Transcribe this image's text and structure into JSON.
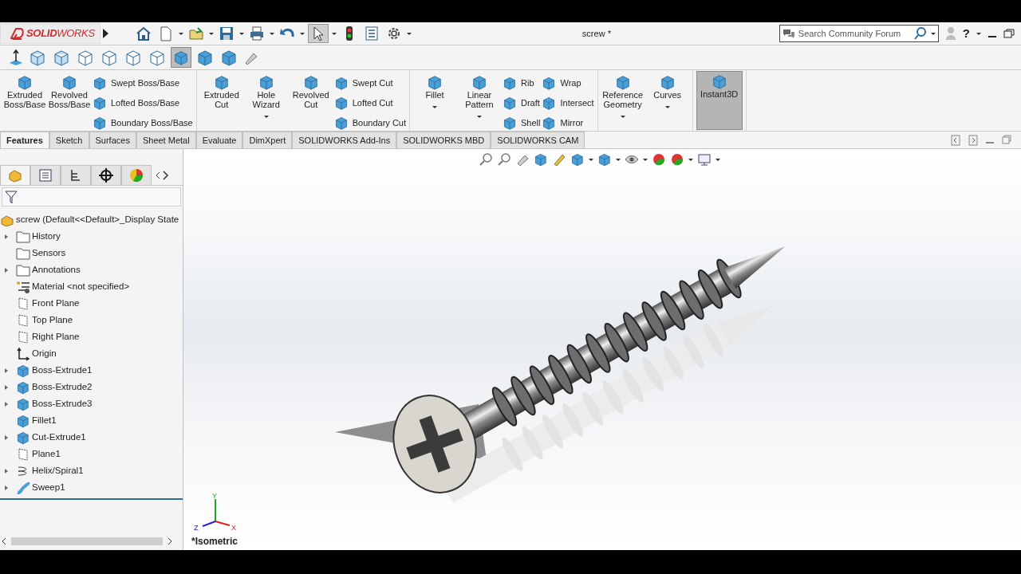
{
  "app": {
    "logo": "**SOLID**WORKS"
  },
  "window": {
    "title": "screw *"
  },
  "search": {
    "placeholder": "Search Community Forum"
  },
  "help": "?",
  "quick_tools": [
    {
      "kind": "home",
      "selected": false
    },
    {
      "kind": "new",
      "selected": false
    },
    {
      "kind": "open",
      "selected": false
    },
    {
      "kind": "save",
      "selected": false
    },
    {
      "kind": "print",
      "selected": false
    },
    {
      "kind": "undo",
      "selected": false
    },
    {
      "kind": "select",
      "selected": true
    },
    {
      "kind": "rebuild",
      "selected": false
    },
    {
      "kind": "file-properties",
      "selected": false
    },
    {
      "kind": "options",
      "selected": false
    }
  ],
  "view_tools": [
    {
      "selected": false
    },
    {
      "selected": false
    },
    {
      "selected": false
    },
    {
      "selected": false
    },
    {
      "selected": false
    },
    {
      "selected": false
    },
    {
      "selected": true
    },
    {
      "selected": false
    },
    {
      "selected": false
    }
  ],
  "ribbon": [
    {
      "items": [
        {
          "kind": "large",
          "label": "Extruded Boss/Base",
          "dropdown": false
        },
        {
          "kind": "large",
          "label": "Revolved Boss/Base",
          "dropdown": false
        },
        {
          "kind": "stack",
          "labels": [
            "Swept Boss/Base",
            "Lofted Boss/Base",
            "Boundary Boss/Base"
          ]
        }
      ]
    },
    {
      "items": [
        {
          "kind": "large",
          "label": "Extruded Cut",
          "dropdown": false
        },
        {
          "kind": "large",
          "label": "Hole Wizard",
          "dropdown": true
        },
        {
          "kind": "large",
          "label": "Revolved Cut",
          "dropdown": false
        },
        {
          "kind": "stack",
          "labels": [
            "Swept Cut",
            "Lofted Cut",
            "Boundary Cut"
          ]
        }
      ]
    },
    {
      "items": [
        {
          "kind": "large",
          "label": "Fillet",
          "dropdown": true
        },
        {
          "kind": "large",
          "label": "Linear Pattern",
          "dropdown": true
        },
        {
          "kind": "stack",
          "labels": [
            "Rib",
            "Draft",
            "Shell"
          ]
        },
        {
          "kind": "stack",
          "labels": [
            "Wrap",
            "Intersect",
            "Mirror"
          ]
        }
      ]
    },
    {
      "items": [
        {
          "kind": "large",
          "label": "Reference Geometry",
          "dropdown": true
        },
        {
          "kind": "large",
          "label": "Curves",
          "dropdown": true
        }
      ]
    },
    {
      "items": [
        {
          "kind": "large",
          "label": "Instant3D",
          "dropdown": false,
          "selected": true
        }
      ]
    }
  ],
  "tabs": [
    {
      "label": "Features",
      "selected": true
    },
    {
      "label": "Sketch",
      "selected": false
    },
    {
      "label": "Surfaces",
      "selected": false
    },
    {
      "label": "Sheet Metal",
      "selected": false
    },
    {
      "label": "Evaluate",
      "selected": false
    },
    {
      "label": "DimXpert",
      "selected": false
    },
    {
      "label": "SOLIDWORKS Add-Ins",
      "selected": false
    },
    {
      "label": "SOLIDWORKS MBD",
      "selected": false
    },
    {
      "label": "SOLIDWORKS CAM",
      "selected": false
    }
  ],
  "panel_tabs": [
    {
      "selected": true
    },
    {
      "selected": false
    },
    {
      "selected": false
    },
    {
      "selected": false
    },
    {
      "selected": false
    }
  ],
  "tree": {
    "root": "screw  (Default<<Default>_Display State",
    "items": [
      {
        "label": "History",
        "kind": "folder",
        "expandable": true
      },
      {
        "label": "Sensors",
        "kind": "folder",
        "expandable": false
      },
      {
        "label": "Annotations",
        "kind": "folder",
        "expandable": true
      },
      {
        "label": "Material <not specified>",
        "kind": "material",
        "expandable": false
      },
      {
        "label": "Front Plane",
        "kind": "plane",
        "expandable": false
      },
      {
        "label": "Top Plane",
        "kind": "plane",
        "expandable": false
      },
      {
        "label": "Right Plane",
        "kind": "plane",
        "expandable": false
      },
      {
        "label": "Origin",
        "kind": "origin",
        "expandable": false
      },
      {
        "label": "Boss-Extrude1",
        "kind": "feature",
        "expandable": true
      },
      {
        "label": "Boss-Extrude2",
        "kind": "feature",
        "expandable": true
      },
      {
        "label": "Boss-Extrude3",
        "kind": "feature",
        "expandable": true
      },
      {
        "label": "Fillet1",
        "kind": "feature",
        "expandable": false
      },
      {
        "label": "Cut-Extrude1",
        "kind": "feature",
        "expandable": true
      },
      {
        "label": "Plane1",
        "kind": "plane",
        "expandable": false
      },
      {
        "label": "Helix/Spiral1",
        "kind": "helix",
        "expandable": true
      },
      {
        "label": "Sweep1",
        "kind": "sweep",
        "expandable": true
      }
    ]
  },
  "triad": {
    "y": "Y",
    "x": "X",
    "z": "Z"
  },
  "view": {
    "orientation": "*Isometric"
  }
}
